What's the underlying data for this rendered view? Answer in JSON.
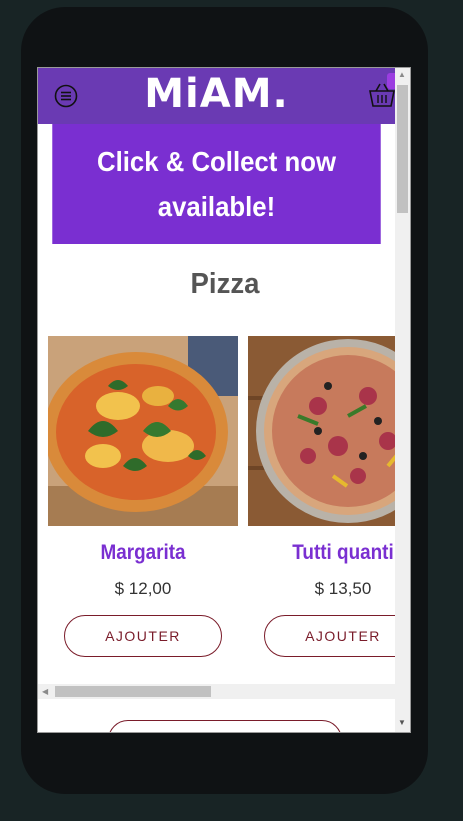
{
  "header": {
    "logo_text": "MiAM.",
    "menu_icon": "hamburger-menu-icon",
    "basket_icon": "basket-icon"
  },
  "banner": {
    "line1": "Click & Collect now",
    "line2": "available!"
  },
  "section": {
    "title": "Pizza"
  },
  "products": [
    {
      "name": "Margarita",
      "price": "$ 12,00",
      "button": "AJOUTER"
    },
    {
      "name": "Tutti quanti",
      "price": "$ 13,50",
      "button": "AJOUTER"
    }
  ],
  "colors": {
    "header_bg": "#6a3ab3",
    "banner_bg": "#7a2fd1",
    "accent_purple": "#7a2fd1",
    "button_border": "#7a1c2a",
    "page_bg": "#182425",
    "phone_frame": "#0f1214"
  }
}
